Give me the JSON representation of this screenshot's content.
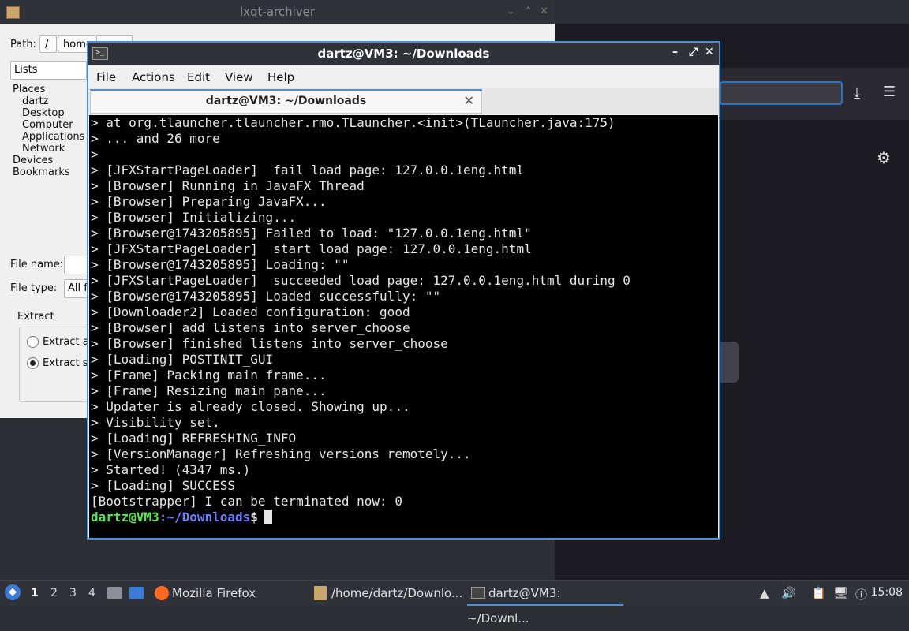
{
  "archiver": {
    "title": "lxqt-archiver",
    "path_label": "Path:",
    "path_buttons": [
      "/",
      "home"
    ],
    "view_combo": "Lists",
    "places": [
      "Places",
      "dartz",
      "Desktop",
      "Computer",
      "Applications",
      "Network",
      "Devices",
      "Bookmarks"
    ],
    "file_name_label": "File name:",
    "file_type_label": "File type:",
    "file_type_value": "All f",
    "extract_label": "Extract",
    "extract_all": "Extract al",
    "extract_selected": "Extract se"
  },
  "terminal": {
    "title": "dartz@VM3: ~/Downloads",
    "menu": [
      "File",
      "Actions",
      "Edit",
      "View",
      "Help"
    ],
    "tab_label": "dartz@VM3: ~/Downloads",
    "lines": [
      "> at org.tlauncher.tlauncher.rmo.TLauncher.<init>(TLauncher.java:175)",
      "> ... and 26 more",
      ">",
      "> [JFXStartPageLoader]  fail load page: 127.0.0.1eng.html",
      "> [Browser] Running in JavaFX Thread",
      "> [Browser] Preparing JavaFX...",
      "> [Browser] Initializing...",
      "> [Browser@1743205895] Failed to load: \"127.0.0.1eng.html\"",
      "> [JFXStartPageLoader]  start load page: 127.0.0.1eng.html",
      "> [Browser@1743205895] Loading: \"\"",
      "> [JFXStartPageLoader]  succeeded load page: 127.0.0.1eng.html during 0",
      "> [Browser@1743205895] Loaded successfully: \"\"",
      "> [Downloader2] Loaded configuration: good",
      "> [Browser] add listens into server_choose",
      "> [Browser] finished listens into server_choose",
      "> [Loading] POSTINIT_GUI",
      "> [Frame] Packing main frame...",
      "> [Frame] Resizing main pane...",
      "> Updater is already closed. Showing up...",
      "> Visibility set.",
      "> [Loading] REFRESHING_INFO",
      "> [VersionManager] Refreshing versions remotely...",
      "> Started! (4347 ms.)",
      "> [Loading] SUCCESS",
      "[Bootstrapper] I can be terminated now: 0"
    ],
    "prompt_user": "dartz@VM3",
    "prompt_path": ":~/Downloads",
    "prompt_symbol": "$"
  },
  "taskbar": {
    "desktops": [
      "1",
      "2",
      "3",
      "4"
    ],
    "tasks": [
      {
        "label": "Mozilla Firefox",
        "icon": "firefox-icon"
      },
      {
        "label": "/home/dartz/Downlo...",
        "icon": "archive-icon"
      },
      {
        "label": "dartz@VM3: ~/Downl...",
        "icon": "terminal-icon"
      }
    ],
    "clock": "15:08"
  },
  "colors": {
    "accent": "#4a90d9",
    "prompt_user": "#55e84b",
    "prompt_path": "#6b7cff",
    "titlebar": "#2f3238"
  }
}
